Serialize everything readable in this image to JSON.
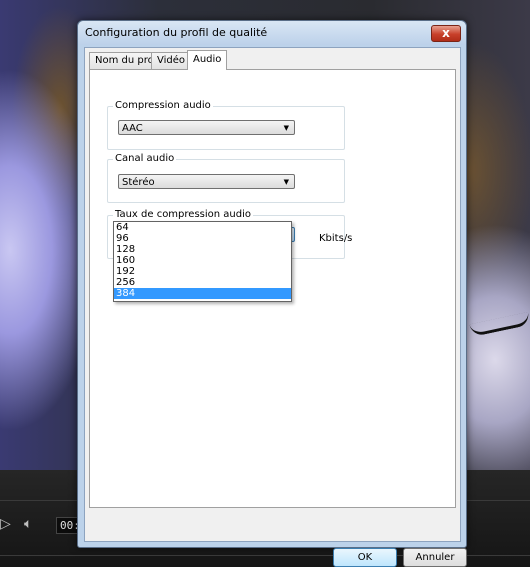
{
  "dialog": {
    "title": "Configuration du profil de qualité",
    "close_label": "x"
  },
  "tabs": [
    {
      "label": "Nom du profil",
      "active": false
    },
    {
      "label": "Vidéo",
      "active": false
    },
    {
      "label": "Audio",
      "active": true
    }
  ],
  "groups": {
    "compression": {
      "label": "Compression audio",
      "value": "AAC"
    },
    "channel": {
      "label": "Canal audio",
      "value": "Stéréo"
    },
    "bitrate": {
      "label": "Taux de compression audio",
      "value": "384",
      "unit": "Kbits/s",
      "options": [
        "64",
        "96",
        "128",
        "160",
        "192",
        "256",
        "384"
      ],
      "selected": "384"
    }
  },
  "buttons": {
    "ok": "OK",
    "cancel": "Annuler"
  },
  "player": {
    "timecode": "00:"
  },
  "icons": [
    "play-icon",
    "volume-icon",
    "chevron-down-icon",
    "close-icon"
  ]
}
